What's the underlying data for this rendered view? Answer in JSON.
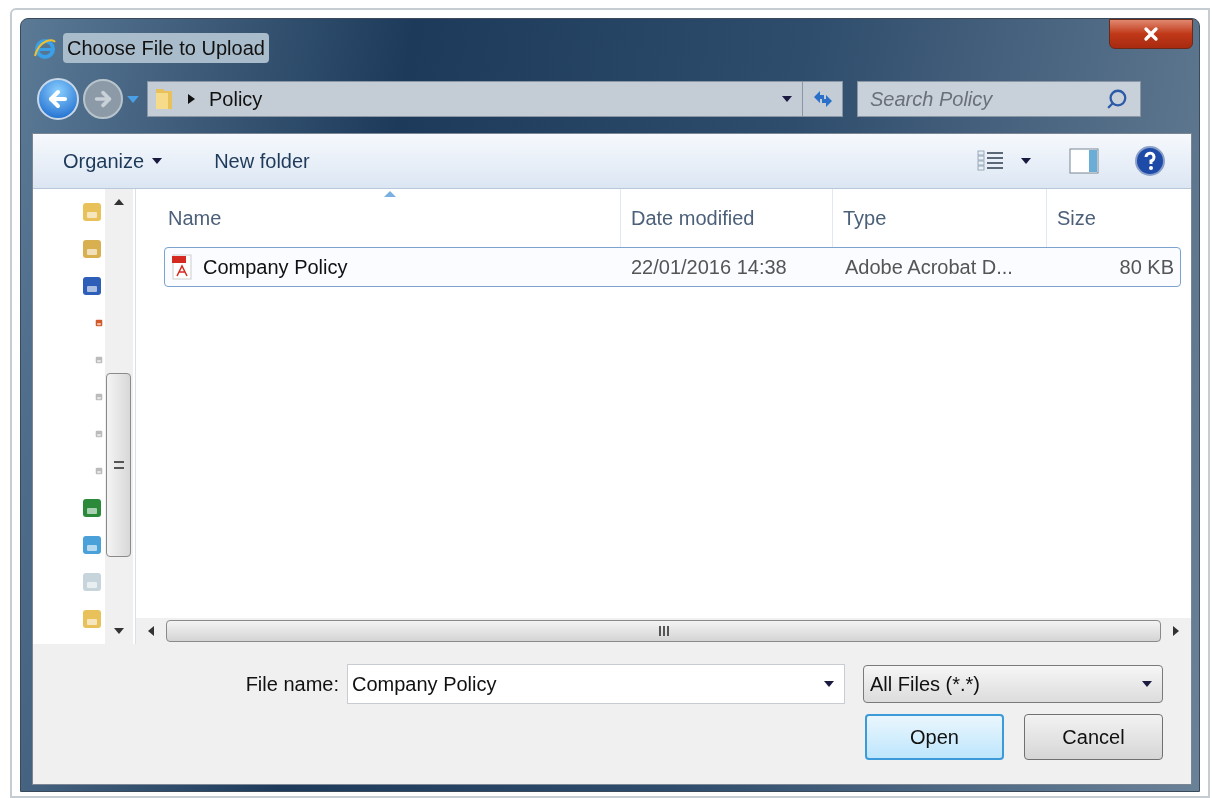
{
  "window": {
    "title": "Choose File to Upload"
  },
  "address_bar": {
    "path": [
      "Policy"
    ]
  },
  "search": {
    "placeholder": "Search Policy"
  },
  "toolbar": {
    "buttons": [
      {
        "label": "Organize",
        "menu": true
      },
      {
        "label": "New folder",
        "menu": false
      }
    ]
  },
  "file_list": {
    "columns": [
      {
        "label": "Name",
        "sorted": true
      },
      {
        "label": "Date modified",
        "sorted": false
      },
      {
        "label": "Type",
        "sorted": false
      },
      {
        "label": "Size",
        "sorted": false
      }
    ],
    "rows": [
      {
        "name": "Company Policy",
        "date_modified": "22/01/2016 14:38",
        "type": "Adobe Acrobat D...",
        "size": "80 KB",
        "selected": true
      }
    ]
  },
  "file_name": {
    "label": "File name:",
    "value": "Company Policy"
  },
  "file_type": {
    "value": "All Files (*.*)"
  },
  "buttons": [
    {
      "label": "Open",
      "default": true
    },
    {
      "label": "Cancel",
      "default": false
    }
  ]
}
